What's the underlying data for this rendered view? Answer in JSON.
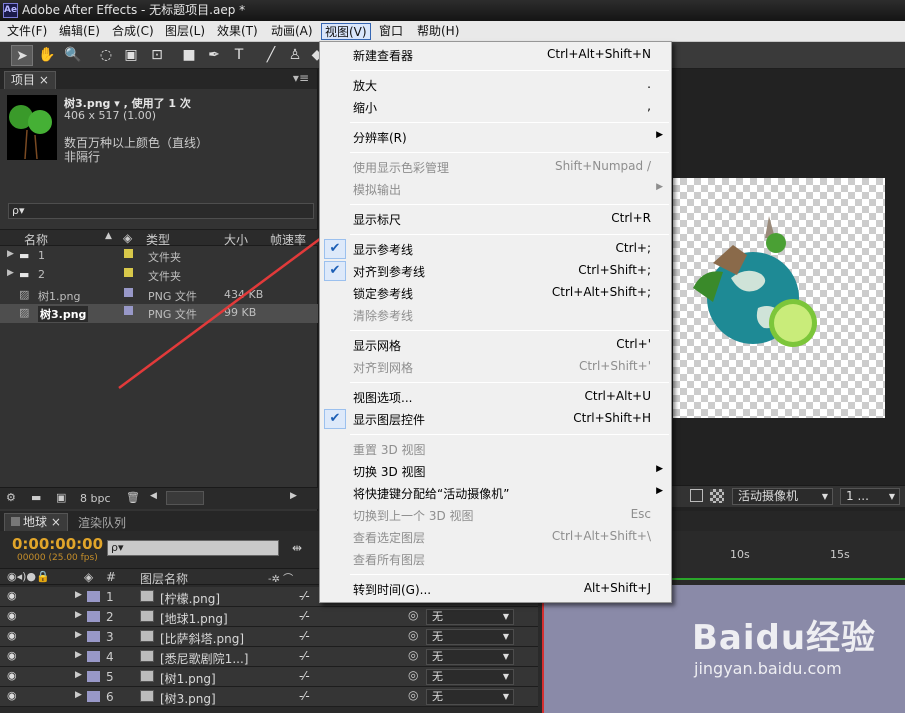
{
  "window": {
    "title": "Adobe After Effects - 无标题项目.aep *",
    "logo": "Ae"
  },
  "menubar": [
    "文件(F)",
    "编辑(E)",
    "合成(C)",
    "图层(L)",
    "效果(T)",
    "动画(A)",
    "视图(V)",
    "窗口",
    "帮助(H)"
  ],
  "project_panel": {
    "tab": "项目",
    "selected_name": "树3.png ▾ , 使用了 1 次",
    "dimensions": "406 x 517 (1.00)",
    "colors": "数百万种以上颜色（直线）",
    "interlace": "非隔行",
    "search_placeholder": "ρ▾",
    "columns": [
      "名称",
      "类型",
      "大小",
      "帧速率"
    ],
    "rows": [
      {
        "name": "1",
        "type": "文件夹",
        "size": "",
        "color": "#d8c84a"
      },
      {
        "name": "2",
        "type": "文件夹",
        "size": "",
        "color": "#d8c84a"
      },
      {
        "name": "树1.png",
        "type": "PNG 文件",
        "size": "434 KB",
        "color": "#9898c8"
      },
      {
        "name": "树3.png",
        "type": "PNG 文件",
        "size": "99 KB",
        "color": "#9898c8"
      }
    ],
    "bpc": "8 bpc"
  },
  "viewer": {
    "camera_label": "活动摄像机",
    "views_label": "1 ..."
  },
  "timeline": {
    "tabs": [
      "地球",
      "渲染队列"
    ],
    "timecode": "0:00:00:00",
    "fps": "00000 (25.00 fps)",
    "search_placeholder": "ρ▾",
    "header_num": "#",
    "header_name": "图层名称",
    "ruler_marks": [
      "10s",
      "15s"
    ],
    "layers": [
      {
        "num": "1",
        "name": "[柠檬.png]",
        "parent": "无"
      },
      {
        "num": "2",
        "name": "[地球1.png]",
        "parent": "无"
      },
      {
        "num": "3",
        "name": "[比萨斜塔.png]",
        "parent": "无"
      },
      {
        "num": "4",
        "name": "[悉尼歌剧院1...]",
        "parent": "无"
      },
      {
        "num": "5",
        "name": "[树1.png]",
        "parent": "无"
      },
      {
        "num": "6",
        "name": "[树3.png]",
        "parent": "无"
      }
    ]
  },
  "view_menu": {
    "new_viewer": {
      "label": "新建查看器",
      "shortcut": "Ctrl+Alt+Shift+N"
    },
    "zoom_in": {
      "label": "放大",
      "shortcut": "."
    },
    "zoom_out": {
      "label": "缩小",
      "shortcut": ","
    },
    "resolution": {
      "label": "分辨率(R)"
    },
    "color_mgmt": {
      "label": "使用显示色彩管理",
      "shortcut": "Shift+Numpad /"
    },
    "simulate_output": {
      "label": "模拟输出"
    },
    "show_rulers": {
      "label": "显示标尺",
      "shortcut": "Ctrl+R"
    },
    "show_guides": {
      "label": "显示参考线",
      "shortcut": "Ctrl+;"
    },
    "snap_guides": {
      "label": "对齐到参考线",
      "shortcut": "Ctrl+Shift+;"
    },
    "lock_guides": {
      "label": "锁定参考线",
      "shortcut": "Ctrl+Alt+Shift+;"
    },
    "clear_guides": {
      "label": "清除参考线"
    },
    "show_grid": {
      "label": "显示网格",
      "shortcut": "Ctrl+'"
    },
    "snap_grid": {
      "label": "对齐到网格",
      "shortcut": "Ctrl+Shift+'"
    },
    "view_options": {
      "label": "视图选项...",
      "shortcut": "Ctrl+Alt+U"
    },
    "show_layer_controls": {
      "label": "显示图层控件",
      "shortcut": "Ctrl+Shift+H"
    },
    "reset_3d": {
      "label": "重置 3D 视图"
    },
    "switch_3d": {
      "label": "切换 3D 视图"
    },
    "assign_shortcut": {
      "label": "将快捷键分配给“活动摄像机”"
    },
    "switch_last_3d": {
      "label": "切换到上一个 3D 视图",
      "shortcut": "Esc"
    },
    "look_selected": {
      "label": "查看选定图层",
      "shortcut": "Ctrl+Alt+Shift+\\"
    },
    "look_all": {
      "label": "查看所有图层"
    },
    "go_to_time": {
      "label": "转到时间(G)...",
      "shortcut": "Alt+Shift+J"
    }
  },
  "watermark": {
    "brand": "Baidu经验",
    "url": "jingyan.baidu.com"
  }
}
